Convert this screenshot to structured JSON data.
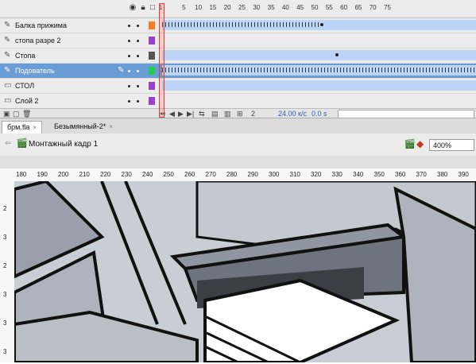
{
  "timeline": {
    "ruler_labels": [
      "1",
      "5",
      "10",
      "15",
      "20",
      "25",
      "30",
      "35",
      "40",
      "45",
      "50",
      "55",
      "60",
      "65",
      "70",
      "75"
    ],
    "header_icons": [
      "eye-icon",
      "lock-icon",
      "outline-icon"
    ],
    "layers": [
      {
        "name": "Балка прижима",
        "color": "#ff7b1a",
        "selected": false
      },
      {
        "name": "стопа разре 2",
        "color": "#9a3fd1",
        "selected": false
      },
      {
        "name": "Стопа",
        "color": "#555555",
        "selected": false
      },
      {
        "name": "Подователь",
        "color": "#22cc55",
        "selected": true
      },
      {
        "name": "СТОЛ",
        "color": "#9a3fd1",
        "selected": false
      },
      {
        "name": "Слой 2",
        "color": "#9a3fd1",
        "selected": false
      }
    ],
    "controls": {
      "current_frame": "2",
      "fps": "24.00 к/с",
      "time": "0.0 s"
    }
  },
  "tabs": [
    {
      "label": "бpм.fla",
      "close": "×",
      "active": true
    },
    {
      "label": "Безымянный-2*",
      "close": "×",
      "active": false
    }
  ],
  "scene": {
    "name": "Монтажный кадр 1",
    "zoom": "400%"
  },
  "ruler_h": [
    "180",
    "190",
    "200",
    "210",
    "220",
    "230",
    "240",
    "250",
    "260",
    "270",
    "280",
    "290",
    "300",
    "310",
    "320",
    "330",
    "340",
    "350",
    "360",
    "370",
    "380",
    "390"
  ],
  "ruler_v": [
    "2",
    "3",
    "2",
    "3",
    "3",
    "3"
  ]
}
